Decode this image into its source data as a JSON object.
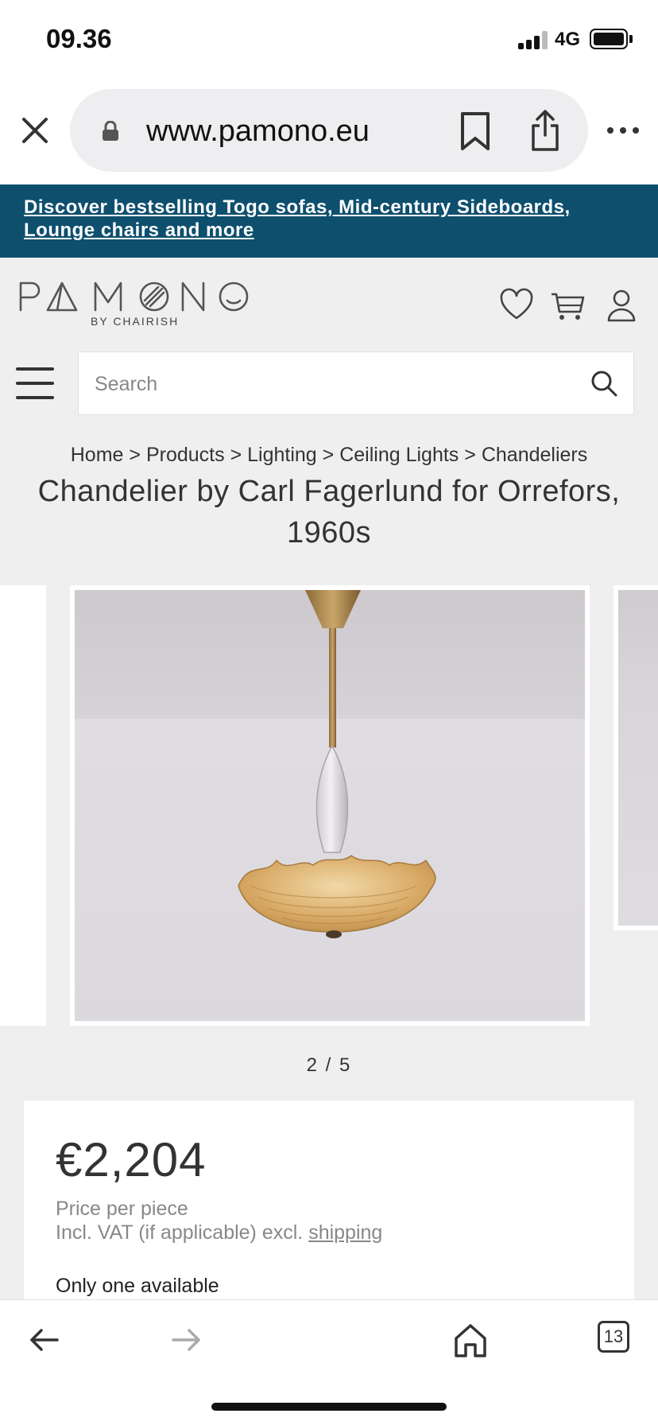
{
  "status_bar": {
    "time": "09.36",
    "network": "4G"
  },
  "browser": {
    "url": "www.pamono.eu"
  },
  "promo": {
    "text": "Discover bestselling Togo sofas, Mid-century Sideboards, Lounge chairs and more"
  },
  "header": {
    "logo_text": "PAMONO",
    "logo_sub": "BY CHAIRISH"
  },
  "search": {
    "placeholder": "Search"
  },
  "breadcrumb": {
    "items": [
      "Home",
      "Products",
      "Lighting",
      "Ceiling Lights",
      "Chandeliers"
    ],
    "separator": ">"
  },
  "product": {
    "title": "Chandelier by Carl Fagerlund for Orrefors, 1960s",
    "gallery_counter": "2 / 5",
    "price": "€2,204",
    "price_unit": "Price per piece",
    "vat_note": "Incl. VAT (if applicable) excl.",
    "shipping_link": "shipping",
    "availability": "Only one available"
  },
  "toolbar": {
    "tabs_count": "13"
  },
  "colors": {
    "banner": "#0e4f6e",
    "page_bg": "#efefef"
  }
}
